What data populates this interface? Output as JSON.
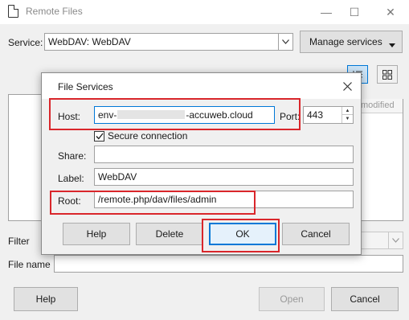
{
  "window": {
    "title": "Remote Files",
    "controls": {
      "minimize": "—",
      "maximize": "☐",
      "close": "✕"
    }
  },
  "service": {
    "label": "Service:",
    "selected": "WebDAV: WebDAV",
    "manage_label": "Manage services"
  },
  "list": {
    "modified_header": "modified"
  },
  "filter": {
    "label": "Filter"
  },
  "filename": {
    "label": "File name",
    "value": ""
  },
  "footer": {
    "help": "Help",
    "open": "Open",
    "cancel": "Cancel"
  },
  "dialog": {
    "title": "File Services",
    "host": {
      "label": "Host:",
      "value_prefix": "env-",
      "value_suffix": "-accuweb.cloud"
    },
    "port": {
      "label": "Port:",
      "value": "443"
    },
    "secure": {
      "label": "Secure connection",
      "checked": true
    },
    "share": {
      "label": "Share:",
      "value": ""
    },
    "label_field": {
      "label": "Label:",
      "value": "WebDAV"
    },
    "root": {
      "label": "Root:",
      "value": "/remote.php/dav/files/admin"
    },
    "buttons": {
      "help": "Help",
      "delete": "Delete",
      "ok": "OK",
      "cancel": "Cancel"
    }
  },
  "colors": {
    "highlight": "#d9262b",
    "focus": "#0078d7",
    "disabled_text": "#9a9a9a"
  }
}
